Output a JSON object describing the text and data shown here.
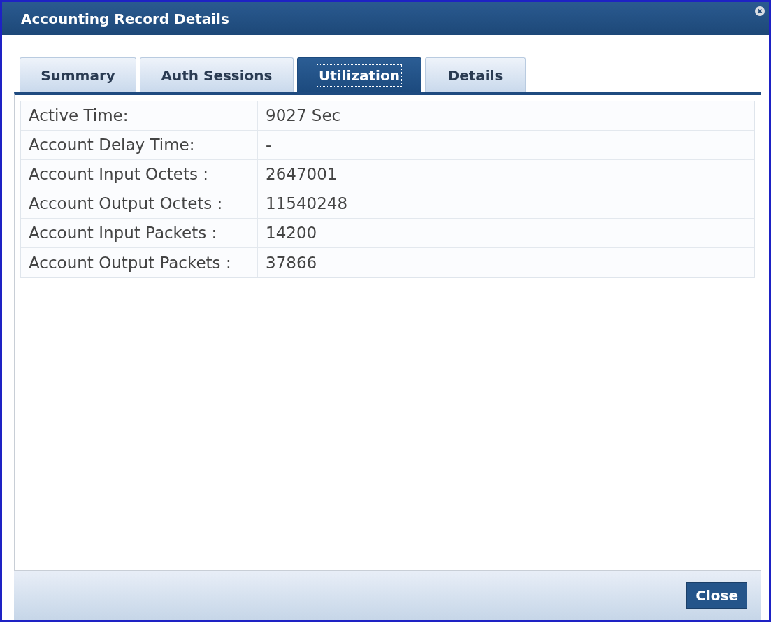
{
  "window": {
    "title": "Accounting Record Details"
  },
  "tabs": [
    {
      "label": "Summary",
      "selected": false
    },
    {
      "label": "Auth Sessions",
      "selected": false
    },
    {
      "label": "Utilization",
      "selected": true
    },
    {
      "label": "Details",
      "selected": false
    }
  ],
  "fields": [
    {
      "label": "Active Time:",
      "value": "9027 Sec"
    },
    {
      "label": "Account Delay Time:",
      "value": "-"
    },
    {
      "label": "Account Input Octets :",
      "value": "2647001"
    },
    {
      "label": "Account Output Octets :",
      "value": "11540248"
    },
    {
      "label": "Account Input Packets :",
      "value": "14200"
    },
    {
      "label": "Account Output Packets :",
      "value": "37866"
    }
  ],
  "buttons": [
    "Close"
  ]
}
